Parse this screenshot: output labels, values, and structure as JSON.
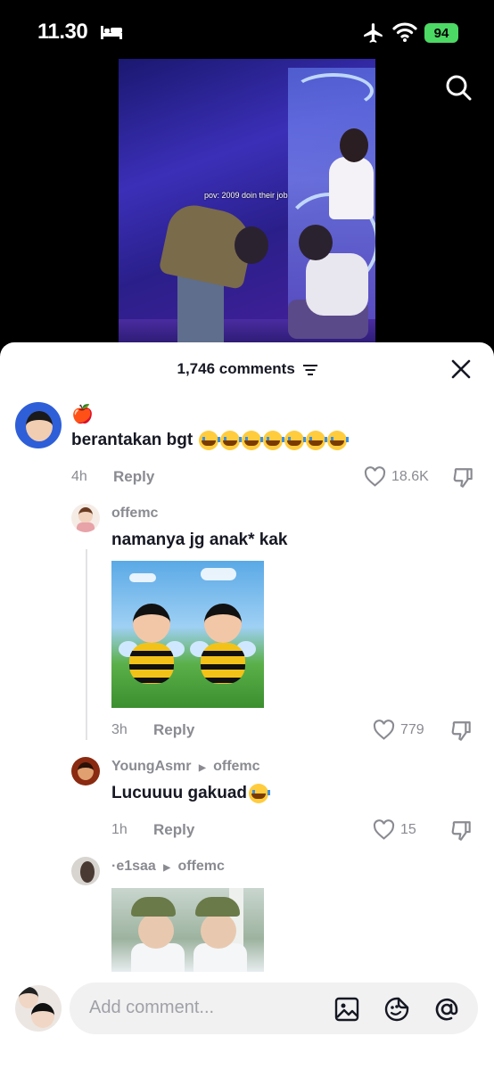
{
  "status_bar": {
    "time": "11.30",
    "battery": "94"
  },
  "video": {
    "caption": "pov: 2009 doin their job"
  },
  "sheet": {
    "comments_count": "1,746 comments"
  },
  "comments": [
    {
      "username_emoji": "🍎",
      "text": "berantakan bgt",
      "time": "4h",
      "reply_label": "Reply",
      "likes": "18.6K"
    },
    {
      "username": "offemc",
      "text": "namanya jg anak* kak",
      "time": "3h",
      "reply_label": "Reply",
      "likes": "779"
    },
    {
      "username": "YoungAsmr",
      "reply_to": "offemc",
      "text": "Lucuuuu gakuad",
      "time": "1h",
      "reply_label": "Reply",
      "likes": "15"
    },
    {
      "username": "·e1saa",
      "reply_to": "offemc"
    }
  ],
  "input": {
    "placeholder": "Add comment..."
  },
  "colors": {
    "like_grey": "#8a8b91",
    "text_dark": "#161823",
    "battery_green": "#4cd964"
  }
}
